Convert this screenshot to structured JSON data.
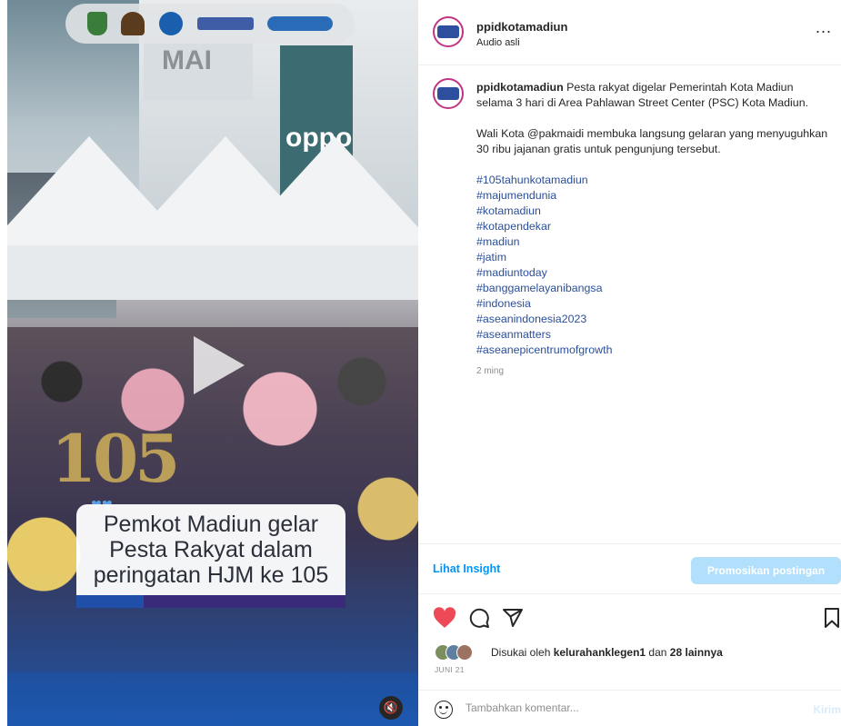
{
  "media": {
    "caption_lines": "Pemkot Madiun gelar\nPesta Rakyat dalam\nperingatan HJM ke 105",
    "anniversary_number": "105",
    "signage_text": "oppo",
    "building_text": "MAI",
    "logos": [
      "logo-pemkot",
      "logo-pendekar",
      "logo-kominfo",
      "LPPL RADIO SUARA MADIUN",
      "MADIUN TODAY"
    ],
    "mute_icon": "speaker-muted-icon"
  },
  "header": {
    "username": "ppidkotamadiun",
    "audio": "Audio asli",
    "more": "..."
  },
  "post": {
    "username": "ppidkotamadiun",
    "body": "Pesta rakyat digelar Pemerintah Kota Madiun selama 3 hari di Area Pahlawan Street Center (PSC) Kota Madiun.",
    "para2": "Wali Kota @pakmaidi membuka langsung gelaran yang menyuguhkan 30 ribu jajanan gratis untuk pengunjung tersebut.",
    "hashtags": [
      "#105tahunkotamadiun",
      "#majumendunia",
      "#kotamadiun",
      "#kotapendekar",
      "#madiun",
      "#jatim",
      "#madiuntoday",
      "#banggamelayanibangsa",
      "#indonesia",
      "#aseanindonesia2023",
      "#aseanmatters",
      "#aseanepicentrumofgrowth"
    ],
    "time": "2 ming"
  },
  "insight": {
    "lihat_label": "Lihat Insight",
    "promo_label": "Promosikan postingan"
  },
  "likes": {
    "prefix": "Disukai oleh ",
    "user": "kelurahanklegen1",
    "middle": " dan ",
    "others": "28 lainnya",
    "date": "JUNI 21"
  },
  "comment": {
    "placeholder": "Tambahkan komentar...",
    "post_label": "Kirim"
  },
  "colors": {
    "like_red": "#ed4956",
    "link_blue": "#0095f6",
    "promo_bg": "#b2dffc",
    "hashtag": "#2b4f9a"
  }
}
